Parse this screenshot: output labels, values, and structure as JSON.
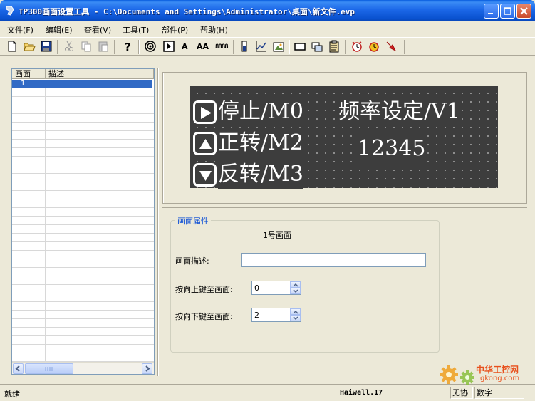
{
  "window": {
    "title": "TP300画面设置工具 - C:\\Documents and Settings\\Administrator\\桌面\\新文件.evp"
  },
  "menu": {
    "items": [
      {
        "label": "文件(F)"
      },
      {
        "label": "编辑(E)"
      },
      {
        "label": "查看(V)"
      },
      {
        "label": "工具(T)"
      },
      {
        "label": "部件(P)"
      },
      {
        "label": "帮助(H)"
      }
    ]
  },
  "toolbar": {
    "text_a": "A",
    "text_aa": "AA",
    "text_num": "8888",
    "icons": [
      "new-file-icon",
      "open-folder-icon",
      "save-icon",
      "cut-icon",
      "copy-icon",
      "paste-icon",
      "help-icon",
      "target-icon",
      "play-key-icon",
      "text-icon",
      "large-text-icon",
      "number-display-icon",
      "bar-icon",
      "line-chart-icon",
      "bitmap-icon",
      "rectangle-icon",
      "screen-link-icon",
      "clipboard-icon",
      "clock-icon",
      "alarm-clock-icon",
      "arrow-icon"
    ]
  },
  "screen_list": {
    "columns": [
      "画面",
      "描述"
    ],
    "rows": [
      {
        "number": "1",
        "description": ""
      }
    ]
  },
  "lcd": {
    "keys": [
      {
        "icon": "play-right-icon",
        "label": "停止/M0"
      },
      {
        "icon": "triangle-up-icon",
        "label": "正转/M2"
      },
      {
        "icon": "triangle-down-icon",
        "label": "反转/M3"
      }
    ],
    "freq_label": "频率设定/V1",
    "freq_value": "12345"
  },
  "properties": {
    "group_title": "画面属性",
    "screen_name": "1号画面",
    "desc_label": "画面描述:",
    "desc_value": "",
    "up_label": "按向上键至画面:",
    "up_value": "0",
    "down_label": "按向下键至画面:",
    "down_value": "2"
  },
  "status": {
    "text": "就绪",
    "brand": "Haiwell.17",
    "panes": [
      "无协",
      "数字"
    ]
  },
  "watermark": {
    "line1": "中华工控网",
    "line2": "gkong.com"
  },
  "colors": {
    "titlebar": "#0A52D0",
    "selection": "#316AC5",
    "lcd_background": "#3D3D3D",
    "group_title": "#0046D5",
    "watermark": "#E8501C"
  }
}
